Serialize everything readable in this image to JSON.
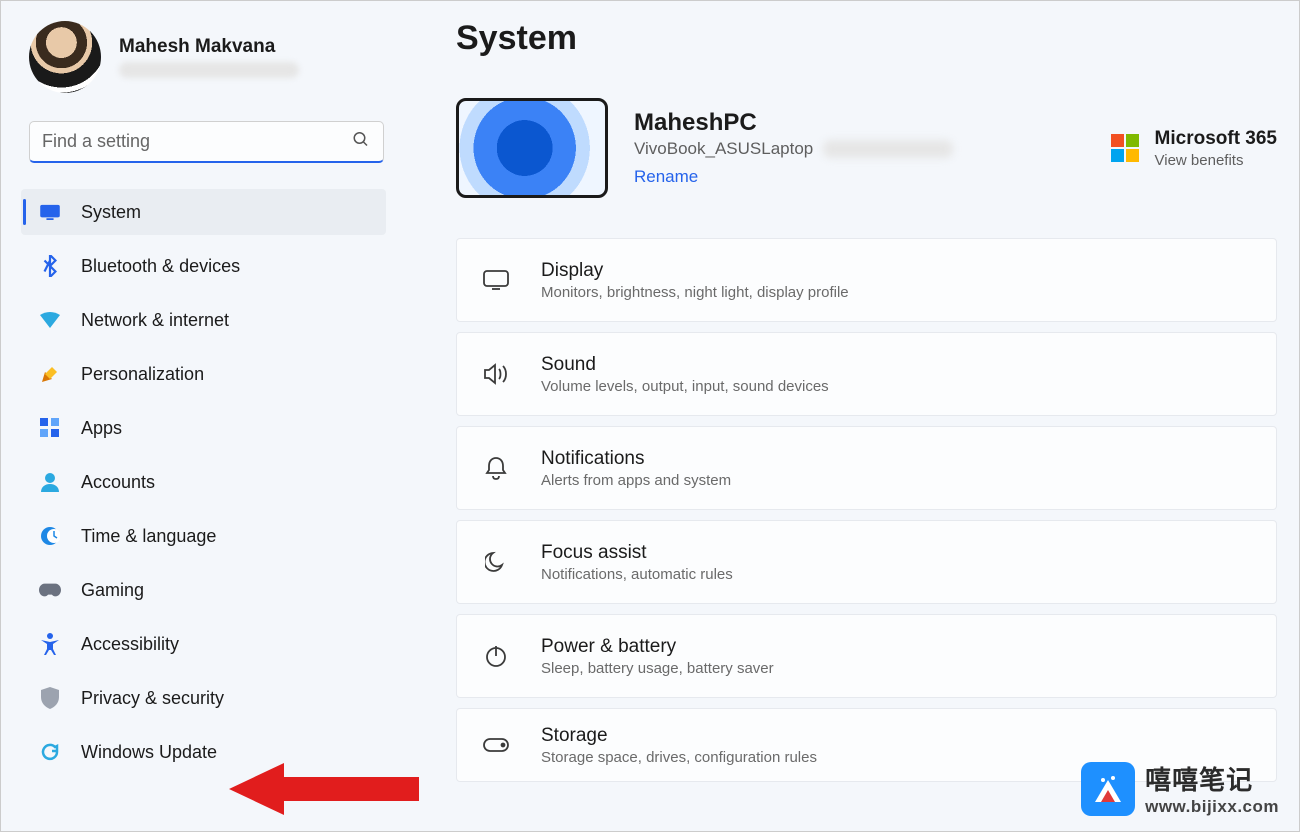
{
  "profile": {
    "name": "Mahesh Makvana"
  },
  "search": {
    "placeholder": "Find a setting"
  },
  "nav": [
    {
      "icon": "system",
      "label": "System"
    },
    {
      "icon": "bluetooth",
      "label": "Bluetooth & devices"
    },
    {
      "icon": "network",
      "label": "Network & internet"
    },
    {
      "icon": "personalization",
      "label": "Personalization"
    },
    {
      "icon": "apps",
      "label": "Apps"
    },
    {
      "icon": "accounts",
      "label": "Accounts"
    },
    {
      "icon": "time",
      "label": "Time & language"
    },
    {
      "icon": "gaming",
      "label": "Gaming"
    },
    {
      "icon": "accessibility",
      "label": "Accessibility"
    },
    {
      "icon": "privacy",
      "label": "Privacy & security"
    },
    {
      "icon": "update",
      "label": "Windows Update"
    }
  ],
  "page": {
    "title": "System",
    "device": {
      "name": "MaheshPC",
      "model": "VivoBook_ASUSLaptop",
      "rename": "Rename"
    },
    "promo": {
      "title": "Microsoft 365",
      "sub": "View benefits"
    }
  },
  "cards": [
    {
      "icon": "display",
      "title": "Display",
      "sub": "Monitors, brightness, night light, display profile"
    },
    {
      "icon": "sound",
      "title": "Sound",
      "sub": "Volume levels, output, input, sound devices"
    },
    {
      "icon": "notifications",
      "title": "Notifications",
      "sub": "Alerts from apps and system"
    },
    {
      "icon": "focus",
      "title": "Focus assist",
      "sub": "Notifications, automatic rules"
    },
    {
      "icon": "power",
      "title": "Power & battery",
      "sub": "Sleep, battery usage, battery saver"
    },
    {
      "icon": "storage",
      "title": "Storage",
      "sub": "Storage space, drives, configuration rules"
    }
  ],
  "watermark": {
    "line1": "嘻嘻笔记",
    "line2": "www.bijixx.com"
  }
}
